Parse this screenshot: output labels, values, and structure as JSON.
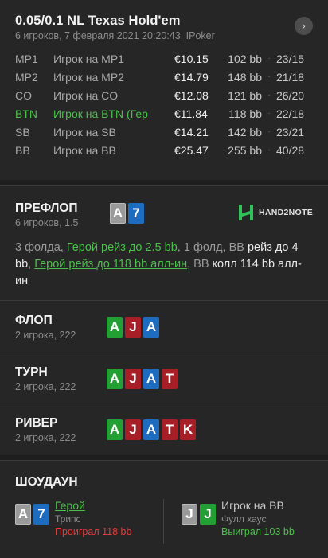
{
  "header": {
    "title": "0.05/0.1 NL Texas Hold'em",
    "subtitle": "6 игроков, 7 февраля 2021 20:20:43, IPoker",
    "nav_icon": "chevron-right-icon",
    "nav_glyph": "›"
  },
  "players": [
    {
      "pos": "MP1",
      "name": "Игрок на MP1",
      "stack": "€10.15",
      "bb": "102 bb",
      "ratio": "23/15"
    },
    {
      "pos": "MP2",
      "name": "Игрок на MP2",
      "stack": "€14.79",
      "bb": "148 bb",
      "ratio": "21/18"
    },
    {
      "pos": "CO",
      "name": "Игрок на CO",
      "stack": "€12.08",
      "bb": "121 bb",
      "ratio": "26/20"
    },
    {
      "pos": "BTN",
      "name": "Игрок на BTN (Гер",
      "stack": "€11.84",
      "bb": "118 bb",
      "ratio": "22/18",
      "hero": true
    },
    {
      "pos": "SB",
      "name": "Игрок на SB",
      "stack": "€14.21",
      "bb": "142 bb",
      "ratio": "23/21"
    },
    {
      "pos": "BB",
      "name": "Игрок на BB",
      "stack": "€25.47",
      "bb": "255 bb",
      "ratio": "40/28"
    }
  ],
  "separator": "·",
  "preflop": {
    "title": "ПРЕФЛОП",
    "sub": "6 игроков, 1.5",
    "cards": [
      {
        "rank": "A",
        "color": "gray"
      },
      {
        "rank": "7",
        "color": "blue"
      }
    ],
    "logo_text": "HAND2NOTE",
    "actions": {
      "a1": "3 фолда, ",
      "a2": "Герой рейз до 2.5 bb",
      "a3": ", 1 фолд, ",
      "a4": "BB",
      "a5": " рейз до 4 bb",
      "a6": ", ",
      "a7": "Герой рейз до 118 bb алл-ин",
      "a8": ", ",
      "a9": "BB",
      "a10": " колл 114 bb алл-ин"
    }
  },
  "flop": {
    "title": "ФЛОП",
    "sub": "2 игрока, 222",
    "cards": [
      {
        "rank": "A",
        "color": "green"
      },
      {
        "rank": "J",
        "color": "red"
      },
      {
        "rank": "A",
        "color": "blue"
      }
    ]
  },
  "turn": {
    "title": "ТУРН",
    "sub": "2 игрока, 222",
    "cards": [
      {
        "rank": "A",
        "color": "green"
      },
      {
        "rank": "J",
        "color": "red"
      },
      {
        "rank": "A",
        "color": "blue"
      },
      {
        "rank": "T",
        "color": "red"
      }
    ]
  },
  "river": {
    "title": "РИВЕР",
    "sub": "2 игрока, 222",
    "cards": [
      {
        "rank": "A",
        "color": "green"
      },
      {
        "rank": "J",
        "color": "red"
      },
      {
        "rank": "A",
        "color": "blue"
      },
      {
        "rank": "T",
        "color": "red"
      },
      {
        "rank": "K",
        "color": "red"
      }
    ]
  },
  "showdown": {
    "title": "ШОУДАУН",
    "hero": {
      "cards": [
        {
          "rank": "A",
          "color": "gray"
        },
        {
          "rank": "7",
          "color": "blue"
        }
      ],
      "name": "Герой",
      "hand": "Трипс",
      "result": "Проиграл 118 bb"
    },
    "villain": {
      "cards": [
        {
          "rank": "J",
          "color": "gray"
        },
        {
          "rank": "J",
          "color": "green"
        }
      ],
      "name": "Игрок на BB",
      "hand": "Фулл хаус",
      "result": "Выиграл 103 bb"
    }
  },
  "colors": {
    "hero_green": "#4cbf4c",
    "loss_red": "#e23c3c",
    "card_blue": "#1e6cc0",
    "card_green": "#23a033",
    "card_red": "#a81e26",
    "card_gray": "#9a9a9a"
  }
}
